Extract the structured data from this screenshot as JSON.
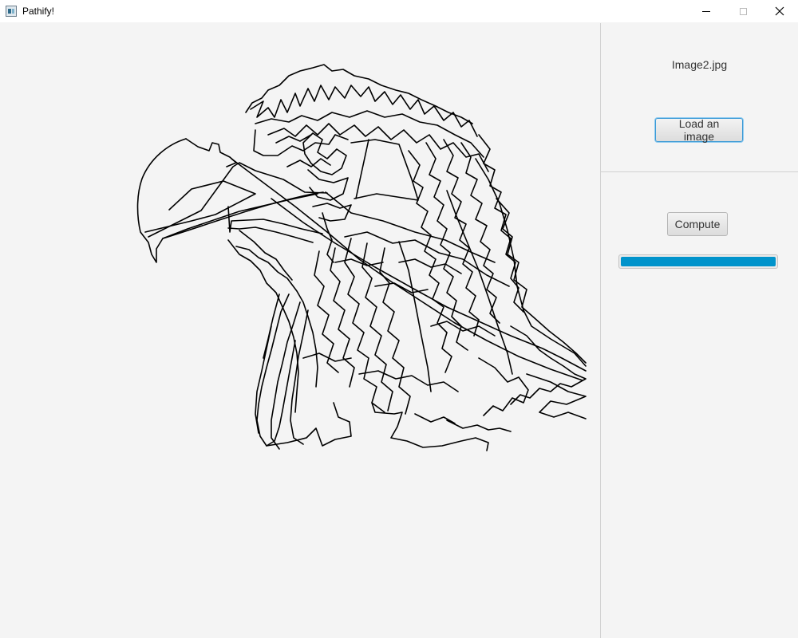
{
  "window": {
    "title": "Pathify!"
  },
  "sidebar": {
    "filename": "Image2.jpg",
    "load_button_label": "Load an image",
    "compute_button_label": "Compute",
    "progress_fraction": 1.0
  },
  "colors": {
    "accent": "#0093cb",
    "focus_border": "#3c9ad6",
    "stroke": "#000000",
    "background": "#f4f4f4"
  },
  "icons": {
    "app": "app-icon",
    "minimize": "minimize-icon",
    "maximize": "maximize-icon",
    "close": "close-icon"
  }
}
